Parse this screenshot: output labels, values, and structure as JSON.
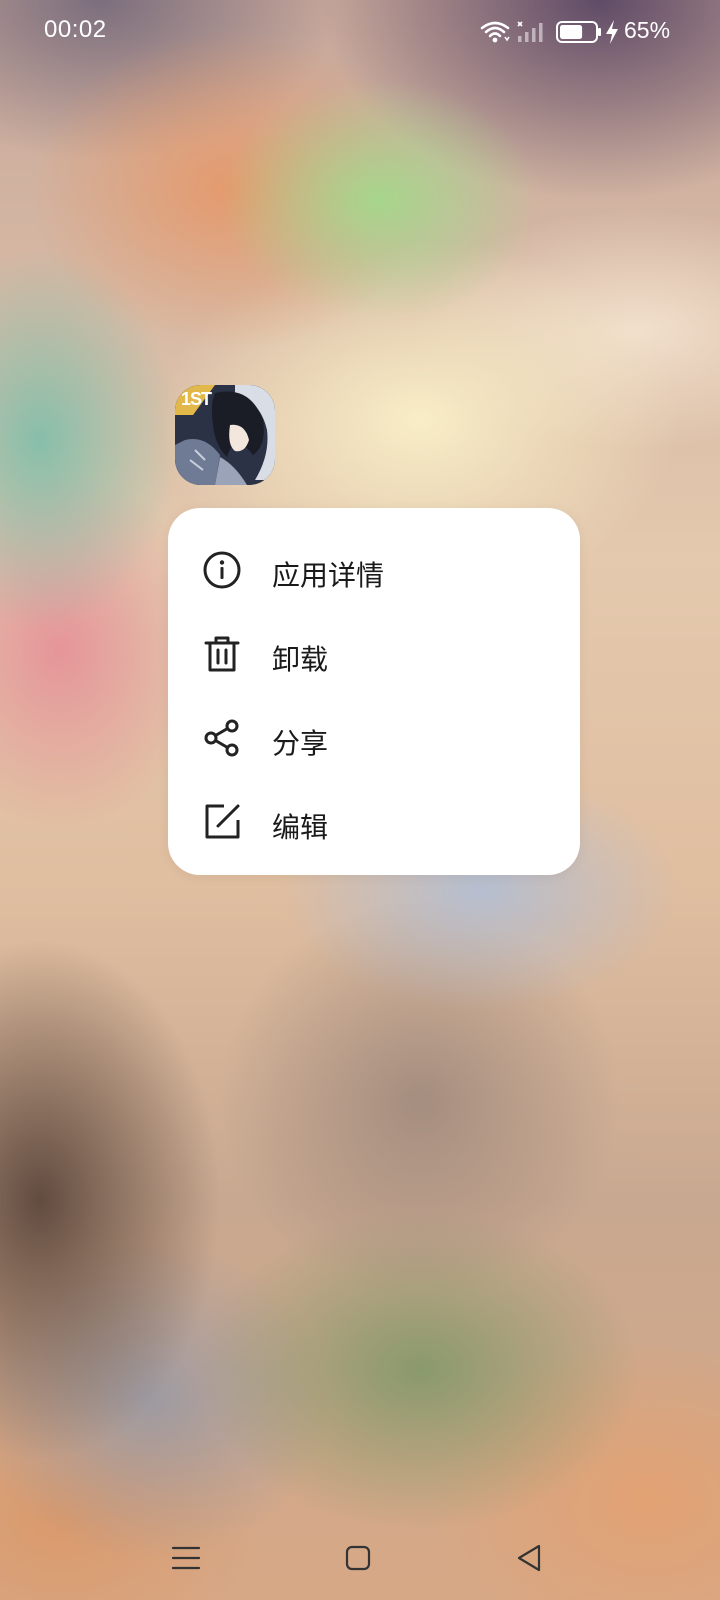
{
  "status_bar": {
    "time": "00:02",
    "battery_percent": "65%",
    "battery_level": 0.65
  },
  "app": {
    "icon_name": "game-app-icon",
    "badge_text": "1ST"
  },
  "context_menu": {
    "items": [
      {
        "label": "应用详情",
        "icon": "info-icon"
      },
      {
        "label": "卸载",
        "icon": "trash-icon"
      },
      {
        "label": "分享",
        "icon": "share-icon"
      },
      {
        "label": "编辑",
        "icon": "edit-icon"
      }
    ]
  },
  "nav_bar": {
    "items": [
      "menu-icon",
      "home-icon",
      "back-icon"
    ]
  },
  "colors": {
    "menu_background": "#ffffff",
    "menu_text": "#1a1a1a",
    "status_text": "#ffffff"
  }
}
